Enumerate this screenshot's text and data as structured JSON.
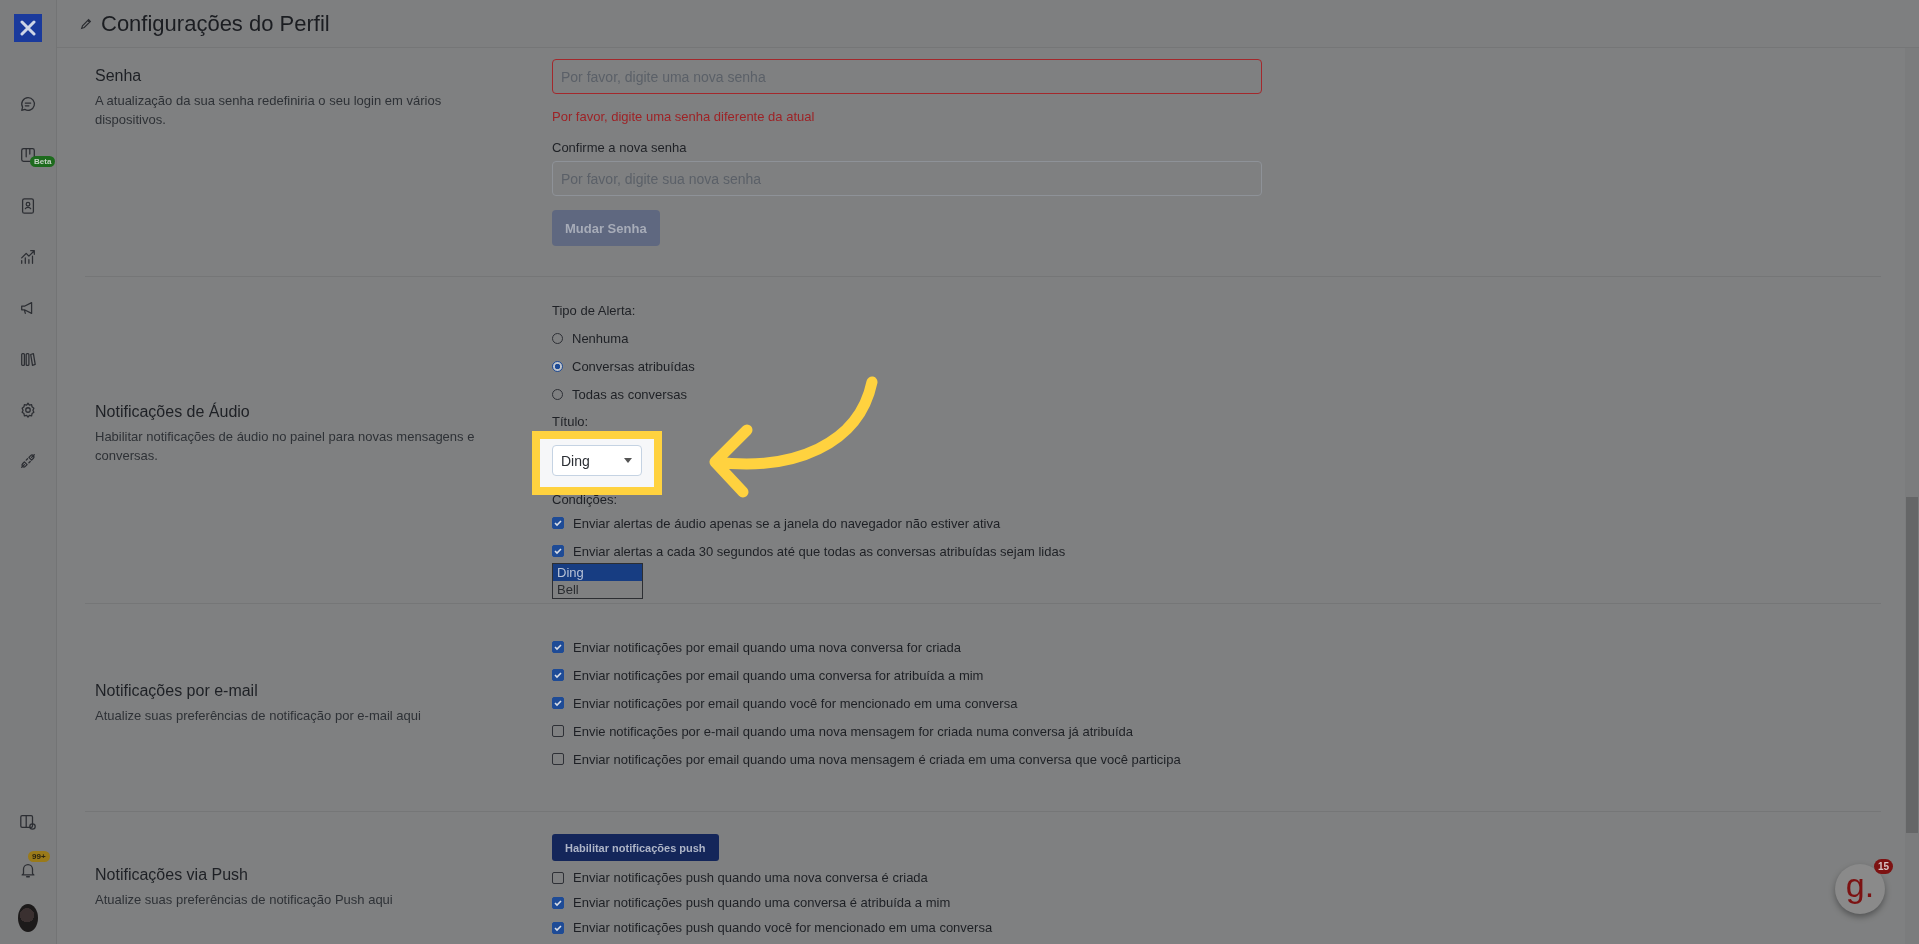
{
  "sidebar": {
    "top_items": [
      {
        "kind": "chat"
      },
      {
        "kind": "board",
        "badge": "Beta"
      },
      {
        "kind": "contacts"
      },
      {
        "kind": "reports"
      },
      {
        "kind": "campaigns"
      },
      {
        "kind": "library"
      },
      {
        "kind": "settings"
      },
      {
        "kind": "integrations"
      }
    ],
    "bottom_items": [
      {
        "kind": "panel"
      },
      {
        "kind": "bell",
        "badge": "99+"
      },
      {
        "kind": "avatar"
      }
    ]
  },
  "header": {
    "title": "Configurações do Perfil"
  },
  "password": {
    "title": "Senha",
    "description": "A atualização da sua senha redefiniria o seu login em vários dispositivos.",
    "new_password": {
      "placeholder": "Por favor, digite uma nova senha",
      "invalid": true
    },
    "error": "Por favor, digite uma senha diferente da atual",
    "confirm": {
      "label": "Confirme a nova senha",
      "placeholder": "Por favor, digite sua nova senha"
    },
    "button": {
      "label": "Mudar Senha",
      "disabled": true
    }
  },
  "audio": {
    "title": "Notificações de Áudio",
    "description": "Habilitar notificações de áudio no painel para novas mensagens e conversas.",
    "alert_type": {
      "label": "Tipo de Alerta:",
      "options": [
        {
          "label": "Nenhuma",
          "selected": false
        },
        {
          "label": "Conversas atribuídas",
          "selected": true
        },
        {
          "label": "Todas as conversas",
          "selected": false
        }
      ]
    },
    "tone": {
      "label": "Título:",
      "value": "Ding",
      "options": [
        {
          "label": "Ding",
          "selected": true
        },
        {
          "label": "Bell",
          "selected": false
        }
      ]
    },
    "conditions": {
      "label": "Condições:",
      "options": [
        {
          "label": "Enviar alertas de áudio apenas se a janela do navegador não estiver ativa",
          "checked": true
        },
        {
          "label": "Enviar alertas a cada 30 segundos até que todas as conversas atribuídas sejam lidas",
          "checked": true
        }
      ]
    }
  },
  "email": {
    "title": "Notificações por e-mail",
    "description": "Atualize suas preferências de notificação por e-mail aqui",
    "options": [
      {
        "label": "Enviar notificações por email quando uma nova conversa for criada",
        "checked": true
      },
      {
        "label": "Enviar notificações por email quando uma conversa for atribuída a mim",
        "checked": true
      },
      {
        "label": "Enviar notificações por email quando você for mencionado em uma conversa",
        "checked": true
      },
      {
        "label": "Envie notificações por e-mail quando uma nova mensagem for criada numa conversa já atribuída",
        "checked": false
      },
      {
        "label": "Enviar notificações por email quando uma nova mensagem é criada em uma conversa que você participa",
        "checked": false
      }
    ]
  },
  "push": {
    "title": "Notificações via Push",
    "description": "Atualize suas preferências de notificação Push aqui",
    "button": "Habilitar notificações push",
    "options": [
      {
        "label": "Enviar notificações push quando uma nova conversa é criada",
        "checked": false
      },
      {
        "label": "Enviar notificações push quando uma conversa é atribuída a mim",
        "checked": true
      },
      {
        "label": "Enviar notificações push quando você for mencionado em uma conversa",
        "checked": true
      }
    ]
  },
  "chat_widget": {
    "logo_text": "g.",
    "badge": "15"
  }
}
